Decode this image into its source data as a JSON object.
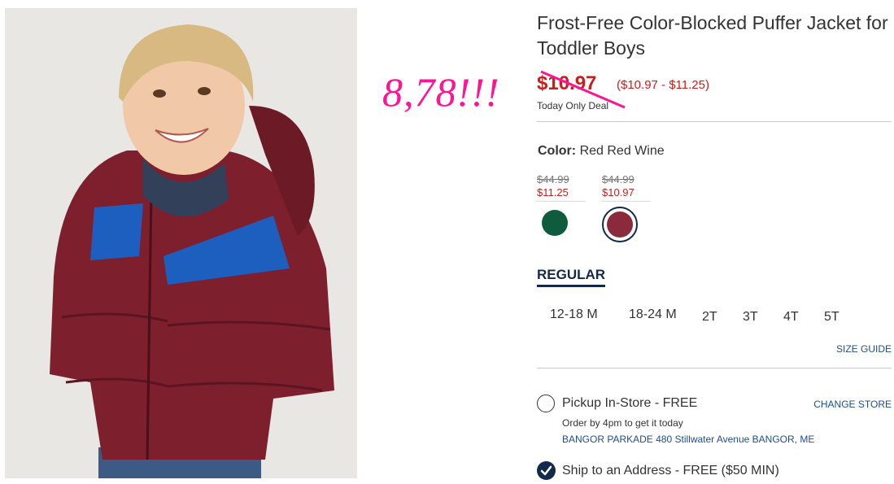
{
  "annotation": "8,78!!!",
  "product": {
    "title": "Frost-Free Color-Blocked Puffer Jacket for Toddler Boys",
    "sale_price": "$10.97",
    "price_range": "($10.97 - $11.25)",
    "deal_label": "Today Only Deal"
  },
  "color": {
    "label": "Color:",
    "selected_name": "Red Red Wine",
    "swatches": [
      {
        "original_price": "$44.99",
        "price": "$11.25",
        "hex": "#0f5b3d"
      },
      {
        "original_price": "$44.99",
        "price": "$10.97",
        "hex": "#8a2a3c"
      }
    ]
  },
  "fit_tab": "REGULAR",
  "sizes": [
    "12-18 M",
    "18-24 M",
    "2T",
    "3T",
    "4T",
    "5T"
  ],
  "size_guide": "SIZE GUIDE",
  "fulfillment": {
    "pickup_label": "Pickup In-Store - FREE",
    "change_store": "CHANGE STORE",
    "order_by": "Order by 4pm to get it today",
    "store_address": "BANGOR PARKADE 480 Stillwater Avenue  BANGOR, ME",
    "ship_label": "Ship to an Address - FREE ($50 MIN)"
  },
  "colors": {
    "sale_red": "#cc1c1c",
    "navy": "#13294b",
    "annotation_pink": "#ff1493",
    "link_blue": "#1f4d8c"
  }
}
